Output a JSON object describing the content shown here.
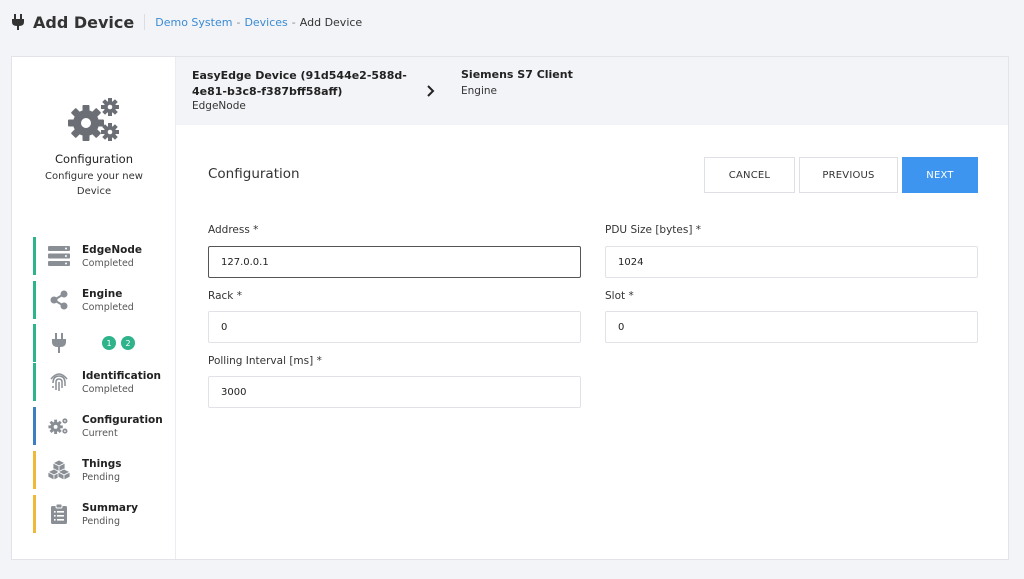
{
  "header": {
    "title": "Add Device",
    "breadcrumb": [
      "Demo System",
      "Devices",
      "Add Device"
    ],
    "breadcrumb_sep": "-"
  },
  "stepper": {
    "heading": "Configuration",
    "subtext": "Configure your new Device",
    "steps": [
      {
        "label": "EdgeNode",
        "state": "Completed",
        "icon": "server-icon"
      },
      {
        "label": "Engine",
        "state": "Completed",
        "icon": "share-icon"
      },
      {
        "label": "",
        "state": "",
        "icon": "plug-icon",
        "badges": [
          "1",
          "2"
        ]
      },
      {
        "label": "Identification",
        "state": "Completed",
        "icon": "fingerprint-icon"
      },
      {
        "label": "Configuration",
        "state": "Current",
        "icon": "gears-icon"
      },
      {
        "label": "Things",
        "state": "Pending",
        "icon": "cubes-icon"
      },
      {
        "label": "Summary",
        "state": "Pending",
        "icon": "clipboard-icon"
      }
    ]
  },
  "device_header": {
    "device_name": "EasyEdge Device (91d544e2-588d-4e81-b3c8-f387bff58aff)",
    "device_type": "EdgeNode",
    "client_name": "Siemens S7 Client",
    "client_type": "Engine"
  },
  "config": {
    "title": "Configuration",
    "buttons": {
      "cancel": "CANCEL",
      "previous": "PREVIOUS",
      "next": "NEXT"
    },
    "fields": {
      "address": {
        "label": "Address *",
        "value": "127.0.0.1"
      },
      "pdu_size": {
        "label": "PDU Size [bytes] *",
        "value": "1024"
      },
      "rack": {
        "label": "Rack *",
        "value": "0"
      },
      "slot": {
        "label": "Slot *",
        "value": "0"
      },
      "polling_interval": {
        "label": "Polling Interval [ms] *",
        "value": "3000"
      }
    }
  },
  "colors": {
    "accent": "#3d95f0",
    "link": "#3a8bd3",
    "completed": "#2fb38a",
    "current": "#3b7fc1",
    "pending": "#efb83a"
  }
}
